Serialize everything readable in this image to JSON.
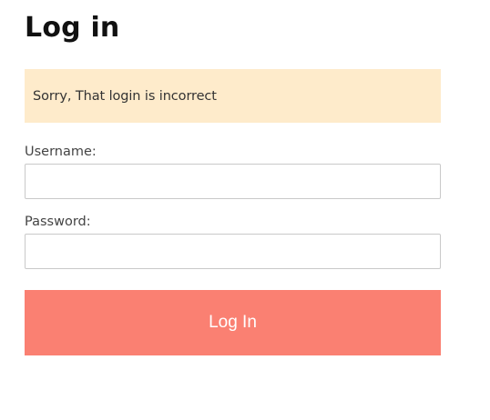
{
  "page": {
    "title": "Log in"
  },
  "alert": {
    "message": "Sorry, That login is incorrect"
  },
  "form": {
    "username_label": "Username:",
    "username_value": "",
    "password_label": "Password:",
    "password_value": "",
    "submit_label": "Log In"
  },
  "colors": {
    "alert_background": "#feebcb",
    "button_background": "#fa8072",
    "button_text": "#ffffff"
  }
}
